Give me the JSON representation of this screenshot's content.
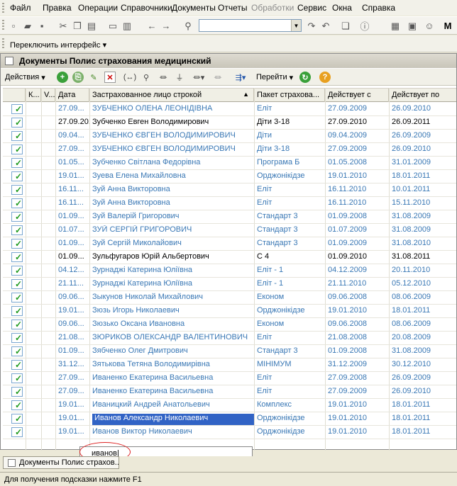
{
  "menu": [
    "Файл",
    "Правка",
    "Операции",
    "Справочники",
    "Документы",
    "Отчеты",
    "Обработки",
    "Сервис",
    "Окна",
    "Справка"
  ],
  "toolbar": {
    "search_value": ""
  },
  "interface_switch": {
    "label": "Переключить интерфейс"
  },
  "document": {
    "title": "Документы Полис страхования медицинский",
    "actions_label": "Действия",
    "goto_label": "Перейти",
    "columns": [
      "К...",
      "V...",
      "Дата",
      "Застрахованное лицо строкой",
      "Пакет страхова...",
      "Действует с",
      "Действует по"
    ],
    "rows": [
      {
        "date": "27.09...",
        "person": "ЗУБЧЕНКО  ОЛЕНА  ЛЕОНІДІВНА",
        "package": "Еліт",
        "from": "27.09.2009",
        "to": "26.09.2010",
        "style": "blue"
      },
      {
        "date": "27.09.2010",
        "person": "Зубченко Евген Володимирович",
        "package": "Діти 3-18",
        "from": "27.09.2010",
        "to": "26.09.2011",
        "style": "black"
      },
      {
        "date": "09.04...",
        "person": "ЗУБЧЕНКО ЄВГЕН ВОЛОДИМИРОВИЧ",
        "package": "Діти",
        "from": "09.04.2009",
        "to": "26.09.2009",
        "style": "blue"
      },
      {
        "date": "27.09...",
        "person": "ЗУБЧЕНКО ЄВГЕН ВОЛОДИМИРОВИЧ",
        "package": "Діти 3-18",
        "from": "27.09.2009",
        "to": "26.09.2010",
        "style": "blue"
      },
      {
        "date": "01.05...",
        "person": "Зубченко Світлана Федорівна",
        "package": "Програма Б",
        "from": "01.05.2008",
        "to": "31.01.2009",
        "style": "blue"
      },
      {
        "date": "19.01...",
        "person": "Зуева Елена  Михайловна",
        "package": "Орджонікідзе",
        "from": "19.01.2010",
        "to": "18.01.2011",
        "style": "blue"
      },
      {
        "date": "16.11...",
        "person": "Зуй Анна Викторовна",
        "package": "Еліт",
        "from": "16.11.2010",
        "to": "10.01.2011",
        "style": "blue"
      },
      {
        "date": "16.11...",
        "person": "Зуй Анна Викторовна",
        "package": "Еліт",
        "from": "16.11.2010",
        "to": "15.11.2010",
        "style": "blue"
      },
      {
        "date": "01.09...",
        "person": "Зуй Валерій Григорович",
        "package": "Стандарт 3",
        "from": "01.09.2008",
        "to": "31.08.2009",
        "style": "blue"
      },
      {
        "date": "01.07...",
        "person": "ЗУЙ СЕРГІЙ ГРИГОРОВИЧ",
        "package": "Стандарт 3",
        "from": "01.07.2009",
        "to": "31.08.2009",
        "style": "blue"
      },
      {
        "date": "01.09...",
        "person": "Зуй Сергій Миколайович",
        "package": "Стандарт 3",
        "from": "01.09.2009",
        "to": "31.08.2010",
        "style": "blue"
      },
      {
        "date": "01.09...",
        "person": "Зульфугаров Юрій Альбертович",
        "package": "С 4",
        "from": "01.09.2010",
        "to": "31.08.2011",
        "style": "black"
      },
      {
        "date": "04.12...",
        "person": "Зурнаджі Катерина Юліївна",
        "package": "Еліт - 1",
        "from": "04.12.2009",
        "to": "20.11.2010",
        "style": "blue"
      },
      {
        "date": "21.11...",
        "person": "Зурнаджі Катерина Юліївна",
        "package": "Еліт - 1",
        "from": "21.11.2010",
        "to": "05.12.2010",
        "style": "blue"
      },
      {
        "date": "09.06...",
        "person": "Зыкунов Николай Михайлович",
        "package": "Економ",
        "from": "09.06.2008",
        "to": "08.06.2009",
        "style": "blue"
      },
      {
        "date": "19.01...",
        "person": "Зюзь   Игорь Николаевич",
        "package": "Орджонікідзе",
        "from": "19.01.2010",
        "to": "18.01.2011",
        "style": "blue"
      },
      {
        "date": "09.06...",
        "person": "Зюзько Оксана Ивановна",
        "package": "Економ",
        "from": "09.06.2008",
        "to": "08.06.2009",
        "style": "blue"
      },
      {
        "date": "21.08...",
        "person": "ЗЮРИКОВ ОЛЕКСАНДР ВАЛЕНТИНОВИЧ",
        "package": "Еліт",
        "from": "21.08.2008",
        "to": "20.08.2009",
        "style": "blue"
      },
      {
        "date": "01.09...",
        "person": "Зябченко Олег Дмитрович",
        "package": "Стандарт 3",
        "from": "01.09.2008",
        "to": "31.08.2009",
        "style": "blue"
      },
      {
        "date": "31.12...",
        "person": "Зятькова Тетяна  Володимирівна",
        "package": "МІНІМУМ",
        "from": "31.12.2009",
        "to": "30.12.2010",
        "style": "blue"
      },
      {
        "date": "27.09...",
        "person": "Иваненко Екатерина Васильевна",
        "package": "Еліт",
        "from": "27.09.2008",
        "to": "26.09.2009",
        "style": "blue"
      },
      {
        "date": "27.09...",
        "person": "Иваненко Екатерина Васильевна",
        "package": "Еліт",
        "from": "27.09.2009",
        "to": "26.09.2010",
        "style": "blue"
      },
      {
        "date": "19.01...",
        "person": "Иваницкий Андрей Анатольевич",
        "package": "Комплекс",
        "from": "19.01.2010",
        "to": "18.01.2011",
        "style": "blue"
      },
      {
        "date": "19.01...",
        "person": "Иванов   Александр Николаевич",
        "package": "Орджонікідзе",
        "from": "19.01.2010",
        "to": "18.01.2011",
        "style": "blue",
        "selected": true
      },
      {
        "date": "19.01...",
        "person": "Иванов  Виктор Николаевич",
        "package": "Орджонікідзе",
        "from": "19.01.2010",
        "to": "18.01.2011",
        "style": "blue"
      }
    ]
  },
  "search_popup": {
    "value": "иванов"
  },
  "window_tab": {
    "label": "Документы Полис страхов..."
  },
  "status": {
    "text": "Для получения подсказки нажмите F1"
  }
}
